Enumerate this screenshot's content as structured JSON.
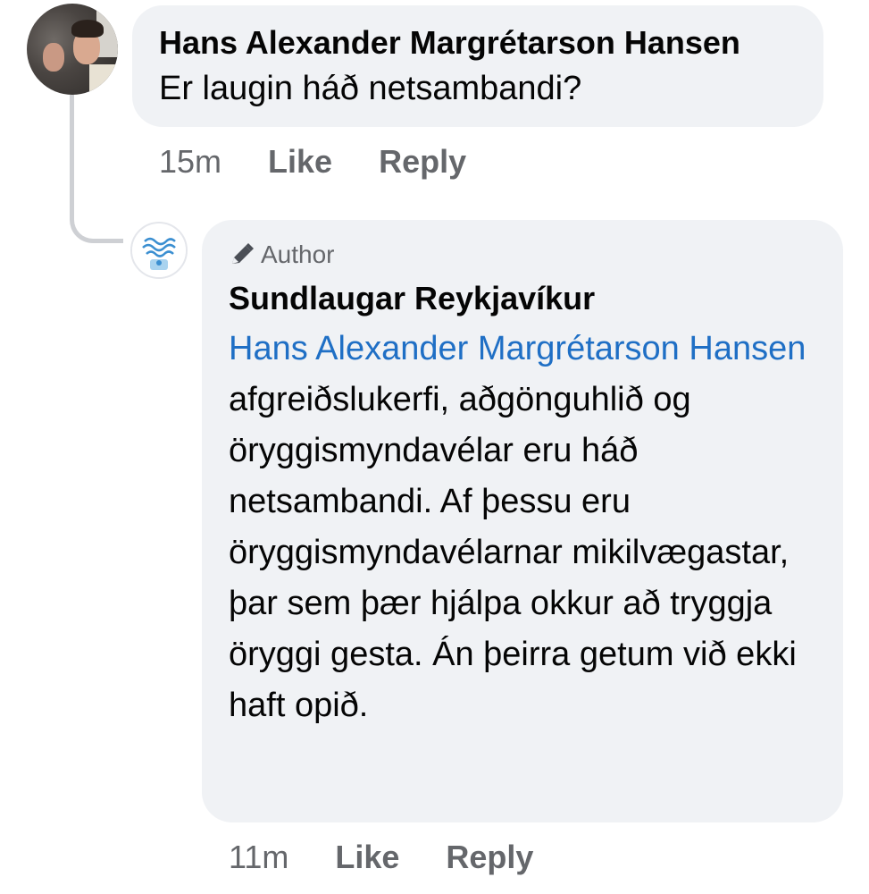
{
  "comments": [
    {
      "author": "Hans Alexander Margrétarson Hansen",
      "text": "Er laugin háð netsambandi?",
      "time": "15m",
      "like_label": "Like",
      "reply_label": "Reply",
      "avatar_icon": "profile-photo"
    }
  ],
  "reply": {
    "badge_label": "Author",
    "badge_icon": "pencil-icon",
    "author": "Sundlaugar Reykjavíkur",
    "mention": "Hans Alexander Margrétarson Hansen",
    "text": " afgreiðslukerfi, aðgönguhlið og öryggismyndavélar eru háð netsambandi. Af þessu eru öryggismyndavélarnar mikilvægastar, þar sem þær hjálpa okkur að tryggja öryggi gesta. Án þeirra getum við ekki haft opið.",
    "time": "11m",
    "like_label": "Like",
    "reply_label": "Reply",
    "avatar_icon": "page-logo"
  },
  "colors": {
    "bubble": "#f0f2f5",
    "mention": "#1f6fc5",
    "meta": "#65676b",
    "thread_line": "#ced0d4"
  }
}
